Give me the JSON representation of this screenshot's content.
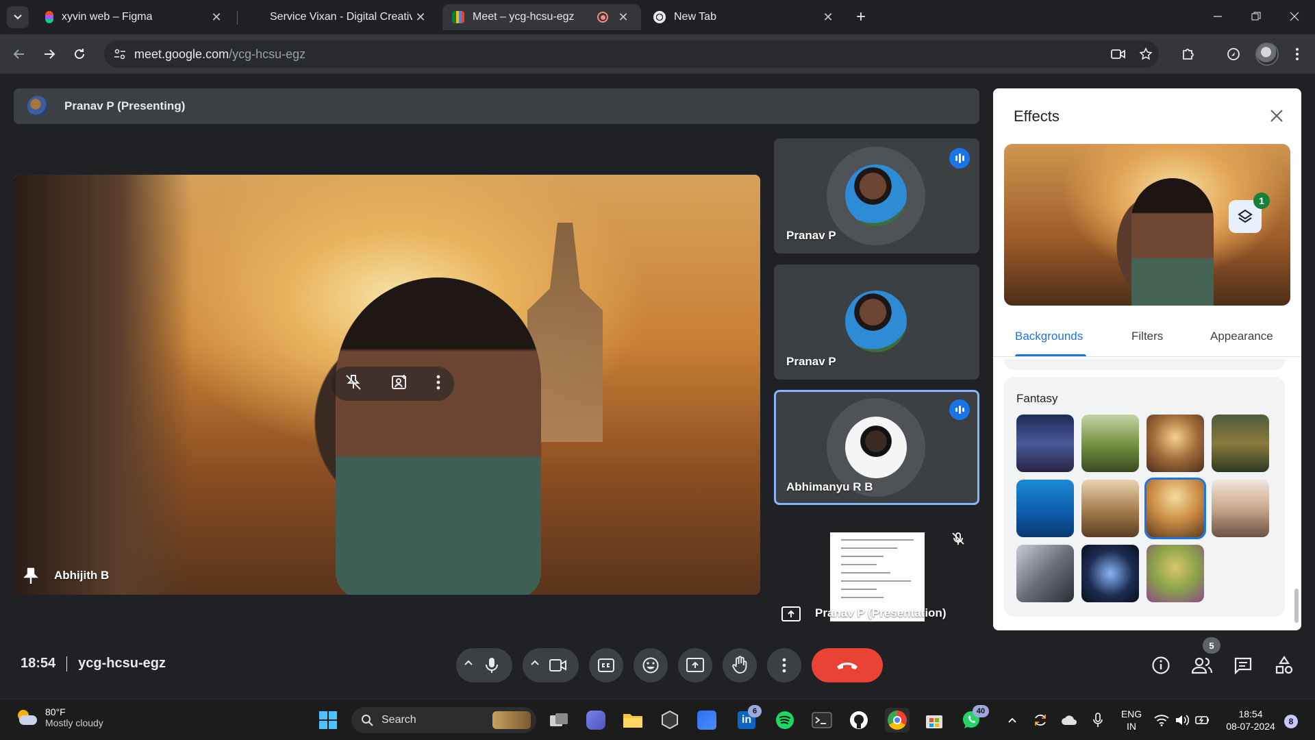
{
  "browser": {
    "tabs": [
      {
        "title": "xyvin web – Figma",
        "icon": "figma-icon"
      },
      {
        "title": "Service Vixan - Digital Creative Agency",
        "icon": "vixan-icon"
      },
      {
        "title": "Meet – ycg-hcsu-egz",
        "icon": "meet-icon",
        "active": true
      },
      {
        "title": "New Tab",
        "icon": "chrome-icon"
      }
    ],
    "url_host": "meet.google.com",
    "url_path": "/ycg-hcsu-egz"
  },
  "meet": {
    "presenting_label": "Pranav P (Presenting)",
    "main_tile_name": "Abhijith B",
    "side_tiles": [
      {
        "name": "Pranav P",
        "speaking": true
      },
      {
        "name": "Pranav P",
        "speaking": false
      },
      {
        "name": "Abhimanyu R B",
        "speaking": true,
        "active": true
      },
      {
        "name": "Pranav P (Presentation)",
        "muted": true
      }
    ],
    "time": "18:54",
    "meeting_code": "ycg-hcsu-egz",
    "people_count": "5"
  },
  "effects": {
    "title": "Effects",
    "layer_badge": "1",
    "tabs": [
      "Backgrounds",
      "Filters",
      "Appearance"
    ],
    "selected_tab": "Backgrounds",
    "group_title": "Fantasy",
    "selected_thumb_index": 6
  },
  "taskbar": {
    "temperature": "80°F",
    "weather": "Mostly cloudy",
    "search_label": "Search",
    "linkedin_badge": "6",
    "whatsapp_badge": "40",
    "lang_1": "ENG",
    "lang_2": "IN",
    "clock_time": "18:54",
    "clock_date": "08-07-2024",
    "notification_count": "8"
  },
  "colors": {
    "accent": "#1a73e8",
    "end_call": "#ea4335",
    "meet_bg": "#202124"
  }
}
